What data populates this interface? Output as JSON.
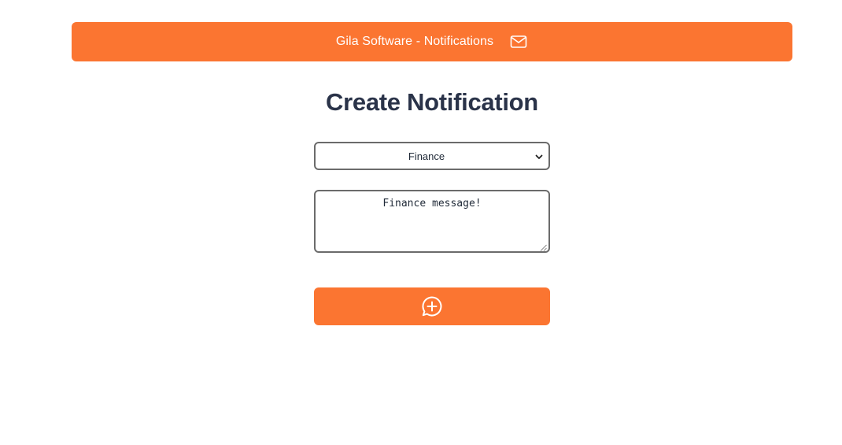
{
  "header": {
    "title": "Gila Software - Notifications",
    "icon": "mail-icon"
  },
  "main": {
    "heading": "Create Notification",
    "category_select": {
      "selected": "Finance"
    },
    "message_field": {
      "value": "Finance message!"
    },
    "submit_button": {
      "icon": "message-plus-icon"
    }
  },
  "colors": {
    "accent": "#fb7531",
    "heading": "#2a3349",
    "border": "#6b6b6b",
    "background": "#ffffff"
  }
}
